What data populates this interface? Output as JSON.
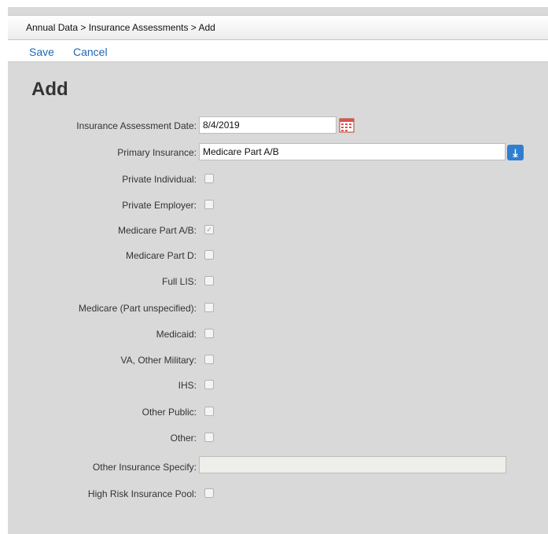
{
  "breadcrumb": {
    "text": "Annual Data > Insurance Assessments > Add"
  },
  "toolbar": {
    "save_label": "Save",
    "cancel_label": "Cancel"
  },
  "page": {
    "title": "Add"
  },
  "form": {
    "assessment_date": {
      "label": "Insurance Assessment Date:",
      "value": "8/4/2019"
    },
    "primary_insurance": {
      "label": "Primary Insurance:",
      "value": "Medicare Part A/B"
    },
    "checkboxes": [
      {
        "label": "Private Individual:",
        "checked": false
      },
      {
        "label": "Private Employer:",
        "checked": false
      },
      {
        "label": "Medicare Part A/B:",
        "checked": true
      },
      {
        "label": "Medicare Part D:",
        "checked": false
      },
      {
        "label": "Full LIS:",
        "checked": false
      },
      {
        "label": "Medicare (Part unspecified):",
        "checked": false
      },
      {
        "label": "Medicaid:",
        "checked": false
      },
      {
        "label": "VA, Other Military:",
        "checked": false
      },
      {
        "label": "IHS:",
        "checked": false
      },
      {
        "label": "Other Public:",
        "checked": false
      },
      {
        "label": "Other:",
        "checked": false
      }
    ],
    "other_insurance_specify": {
      "label": "Other Insurance Specify:",
      "value": ""
    },
    "high_risk_pool": {
      "label": "High Risk Insurance Pool:",
      "checked": false
    }
  },
  "icons": {
    "calendar": "calendar-icon",
    "dropdown": "download-arrow-icon"
  },
  "colors": {
    "accent": "#1f66b5",
    "panel": "#d9d9d9",
    "dropdown_button": "#2f7ed0"
  }
}
